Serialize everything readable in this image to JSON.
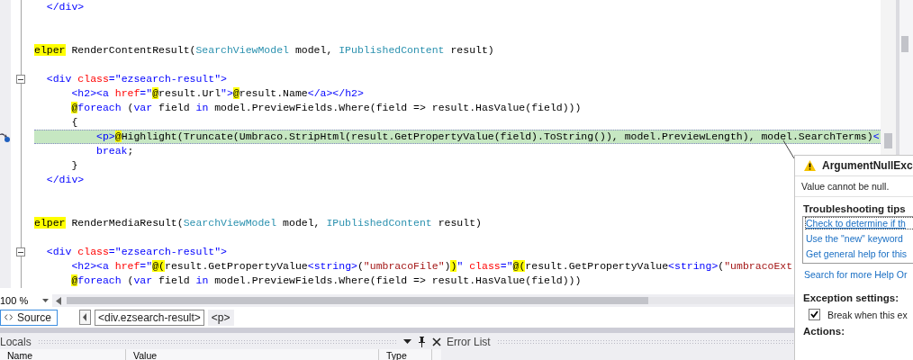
{
  "editor": {
    "lines": [
      {
        "fold": false,
        "current": false,
        "tokens": [
          {
            "kind": "tag",
            "text": "  </div>"
          }
        ]
      },
      {
        "fold": false,
        "current": false
      },
      {
        "fold": false,
        "current": false
      },
      {
        "fold": false,
        "current": false,
        "tokens": [
          {
            "kind": "razor",
            "text": "elper"
          },
          {
            "kind": "text",
            "text": " RenderContentResult("
          },
          {
            "kind": "type",
            "text": "SearchViewModel"
          },
          {
            "kind": "text",
            "text": " model, "
          },
          {
            "kind": "type",
            "text": "IPublishedContent"
          },
          {
            "kind": "text",
            "text": " result)"
          }
        ]
      },
      {
        "fold": false,
        "current": false
      },
      {
        "fold": true,
        "current": false,
        "tokens": [
          {
            "kind": "tag",
            "text": "  <div"
          },
          {
            "kind": "attr",
            "text": " class"
          },
          {
            "kind": "tag",
            "text": "="
          },
          {
            "kind": "attrval",
            "text": "\"ezsearch-result\""
          },
          {
            "kind": "tag",
            "text": ">"
          }
        ]
      },
      {
        "fold": false,
        "current": false,
        "tokens": [
          {
            "kind": "tag",
            "text": "      <h2><a"
          },
          {
            "kind": "attr",
            "text": " href"
          },
          {
            "kind": "tag",
            "text": "="
          },
          {
            "kind": "attrval",
            "text": "\""
          },
          {
            "kind": "razor",
            "text": "@"
          },
          {
            "kind": "text",
            "text": "result.Url"
          },
          {
            "kind": "attrval",
            "text": "\""
          },
          {
            "kind": "tag",
            "text": ">"
          },
          {
            "kind": "razor",
            "text": "@"
          },
          {
            "kind": "text",
            "text": "result.Name"
          },
          {
            "kind": "tag",
            "text": "</a></h2>"
          }
        ]
      },
      {
        "fold": false,
        "current": false,
        "tokens": [
          {
            "kind": "razor",
            "text": "      @"
          },
          {
            "kind": "kw",
            "text": "foreach"
          },
          {
            "kind": "text",
            "text": " ("
          },
          {
            "kind": "kw",
            "text": "var"
          },
          {
            "kind": "text",
            "text": " field "
          },
          {
            "kind": "kw",
            "text": "in"
          },
          {
            "kind": "text",
            "text": " model.PreviewFields.Where(field => result.HasValue(field)))"
          }
        ]
      },
      {
        "fold": false,
        "current": false,
        "tokens": [
          {
            "kind": "text",
            "text": "      {"
          }
        ]
      },
      {
        "fold": false,
        "current": true,
        "tokens": [
          {
            "kind": "tag",
            "text": "          <p>"
          },
          {
            "kind": "razor",
            "text": "@"
          },
          {
            "kind": "text",
            "text": "Highlight(Truncate(Umbraco.StripHtml(result.GetPropertyValue(field).ToString()), model.PreviewLength), model.SearchTerms)"
          },
          {
            "kind": "tag",
            "text": "<"
          }
        ]
      },
      {
        "fold": false,
        "current": false,
        "tokens": [
          {
            "kind": "kw",
            "text": "          break"
          },
          {
            "kind": "text",
            "text": ";"
          }
        ]
      },
      {
        "fold": false,
        "current": false,
        "tokens": [
          {
            "kind": "text",
            "text": "      }"
          }
        ]
      },
      {
        "fold": false,
        "current": false,
        "tokens": [
          {
            "kind": "tag",
            "text": "  </div>"
          }
        ]
      },
      {
        "fold": false,
        "current": false
      },
      {
        "fold": false,
        "current": false
      },
      {
        "fold": false,
        "current": false,
        "tokens": [
          {
            "kind": "razor",
            "text": "elper"
          },
          {
            "kind": "text",
            "text": " RenderMediaResult("
          },
          {
            "kind": "type",
            "text": "SearchViewModel"
          },
          {
            "kind": "text",
            "text": " model, "
          },
          {
            "kind": "type",
            "text": "IPublishedContent"
          },
          {
            "kind": "text",
            "text": " result)"
          }
        ]
      },
      {
        "fold": false,
        "current": false
      },
      {
        "fold": true,
        "current": false,
        "tokens": [
          {
            "kind": "tag",
            "text": "  <div"
          },
          {
            "kind": "attr",
            "text": " class"
          },
          {
            "kind": "tag",
            "text": "="
          },
          {
            "kind": "attrval",
            "text": "\"ezsearch-result\""
          },
          {
            "kind": "tag",
            "text": ">"
          }
        ]
      },
      {
        "fold": false,
        "current": false,
        "tokens": [
          {
            "kind": "tag",
            "text": "      <h2><a"
          },
          {
            "kind": "attr",
            "text": " href"
          },
          {
            "kind": "tag",
            "text": "="
          },
          {
            "kind": "attrval",
            "text": "\""
          },
          {
            "kind": "razor",
            "text": "@("
          },
          {
            "kind": "text",
            "text": "result.GetPropertyValue"
          },
          {
            "kind": "tag",
            "text": "<"
          },
          {
            "kind": "kw",
            "text": "string"
          },
          {
            "kind": "tag",
            "text": ">"
          },
          {
            "kind": "text",
            "text": "("
          },
          {
            "kind": "str",
            "text": "\"umbracoFile\""
          },
          {
            "kind": "text",
            "text": ")"
          },
          {
            "kind": "razor",
            "text": ")"
          },
          {
            "kind": "attrval",
            "text": "\""
          },
          {
            "kind": "attr",
            "text": " class"
          },
          {
            "kind": "tag",
            "text": "="
          },
          {
            "kind": "attrval",
            "text": "\""
          },
          {
            "kind": "razor",
            "text": "@("
          },
          {
            "kind": "text",
            "text": "result.GetPropertyValue"
          },
          {
            "kind": "tag",
            "text": "<"
          },
          {
            "kind": "kw",
            "text": "string"
          },
          {
            "kind": "tag",
            "text": ">"
          },
          {
            "kind": "text",
            "text": "("
          },
          {
            "kind": "str",
            "text": "\"umbracoExt"
          }
        ]
      },
      {
        "fold": false,
        "current": false,
        "tokens": [
          {
            "kind": "razor",
            "text": "      @"
          },
          {
            "kind": "kw",
            "text": "foreach"
          },
          {
            "kind": "text",
            "text": " ("
          },
          {
            "kind": "kw",
            "text": "var"
          },
          {
            "kind": "text",
            "text": " field "
          },
          {
            "kind": "kw",
            "text": "in"
          },
          {
            "kind": "text",
            "text": " model.PreviewFields.Where(field => result.HasValue(field)))"
          }
        ]
      }
    ]
  },
  "zoom": "100 %",
  "tabs": [
    {
      "label": "Source",
      "selected": true
    }
  ],
  "breadcrumb": [
    {
      "label": "<div.ezsearch-result>",
      "selected": true
    },
    {
      "label": "<p>",
      "selected": false
    }
  ],
  "locals": {
    "title": "Locals",
    "columns": [
      "Name",
      "Value",
      "Type"
    ]
  },
  "error_list": {
    "title": "Error List"
  },
  "exception": {
    "title": "ArgumentNullExc",
    "message": "Value cannot be null.",
    "tips_heading": "Troubleshooting tips",
    "tips": [
      "Check to determine if th",
      "Use the \"new\" keyword",
      "Get general help for this"
    ],
    "search_link": "Search for more Help Or",
    "settings_heading": "Exception settings:",
    "break_option": {
      "label": "Break when this ex",
      "checked": true
    },
    "actions_heading": "Actions:"
  }
}
